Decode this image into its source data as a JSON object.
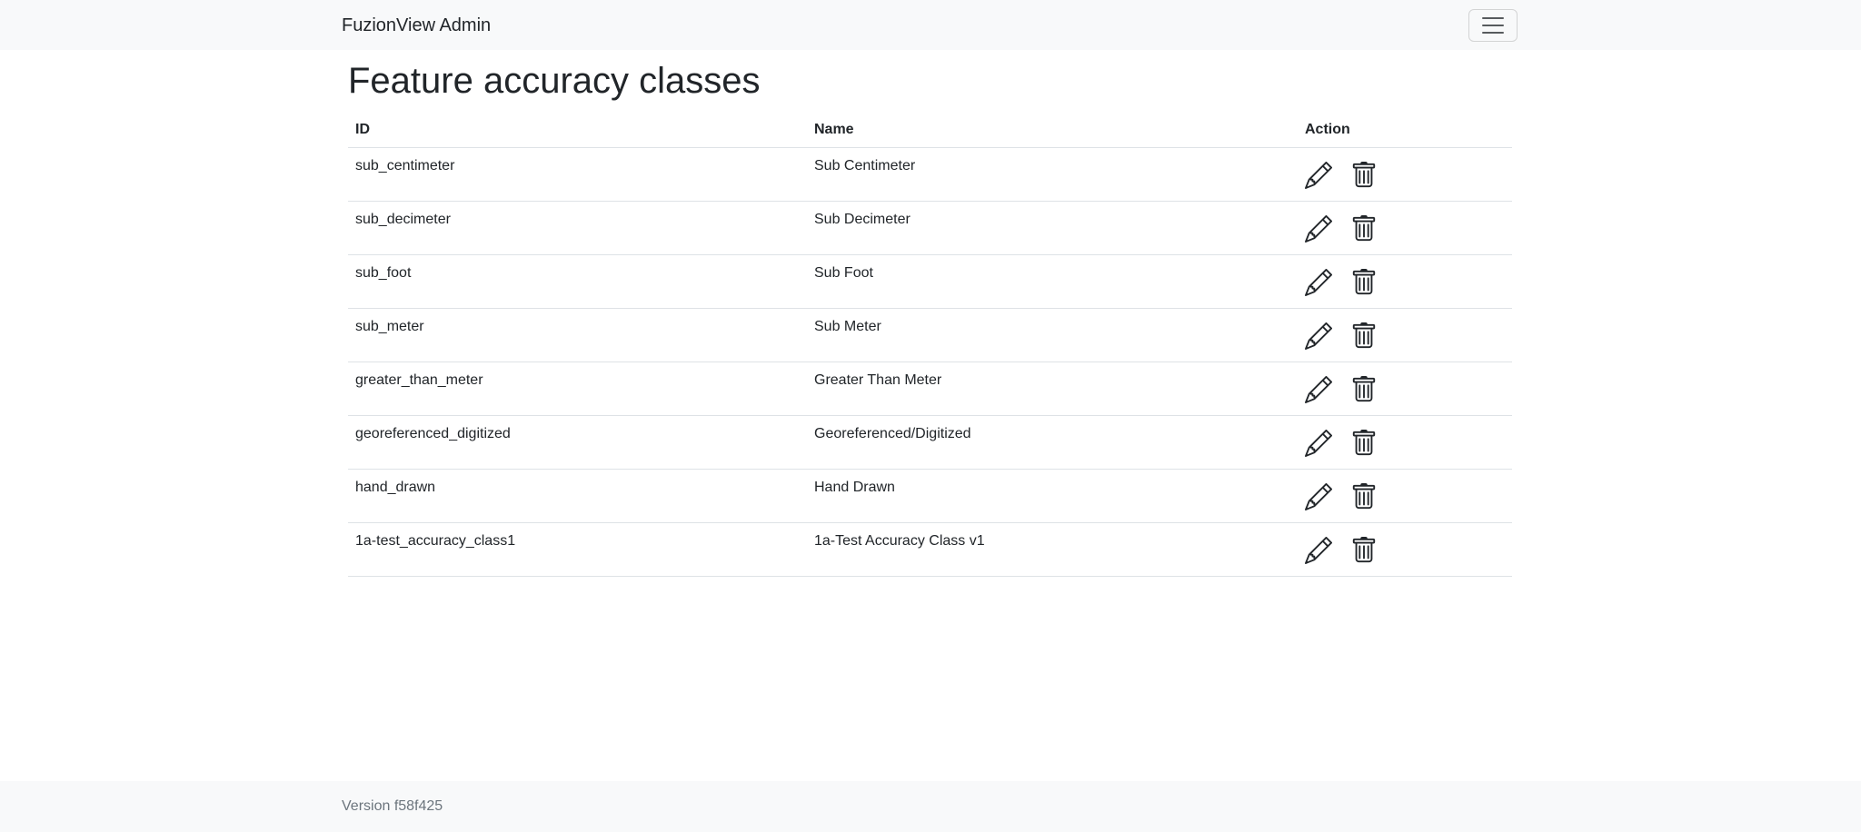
{
  "navbar": {
    "brand": "FuzionView Admin",
    "toggler_icon": "hamburger-menu-icon"
  },
  "page": {
    "title": "Feature accuracy classes"
  },
  "table": {
    "columns": [
      "ID",
      "Name",
      "Action"
    ],
    "rows": [
      {
        "id": "sub_centimeter",
        "name": "Sub Centimeter"
      },
      {
        "id": "sub_decimeter",
        "name": "Sub Decimeter"
      },
      {
        "id": "sub_foot",
        "name": "Sub Foot"
      },
      {
        "id": "sub_meter",
        "name": "Sub Meter"
      },
      {
        "id": "greater_than_meter",
        "name": "Greater Than Meter"
      },
      {
        "id": "georeferenced_digitized",
        "name": "Georeferenced/Digitized"
      },
      {
        "id": "hand_drawn",
        "name": "Hand Drawn"
      },
      {
        "id": "1a-test_accuracy_class1",
        "name": "1a-Test Accuracy Class v1"
      }
    ],
    "action_icons": [
      "pencil-icon",
      "trash-icon"
    ]
  },
  "footer": {
    "version": "Version f58f425"
  },
  "colors": {
    "navbar_bg": "#f8f9fa",
    "text": "#212529",
    "muted": "#6c757d",
    "border": "#dee2e6"
  }
}
